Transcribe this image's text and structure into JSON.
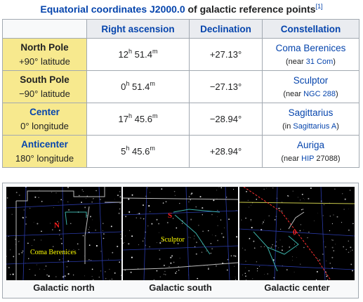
{
  "caption": {
    "link_text": "Equatorial coordinates J2000.0",
    "rest_text": " of galactic reference points",
    "ref": "[1]"
  },
  "table": {
    "headers": [
      "Right ascension",
      "Declination",
      "Constellation"
    ],
    "rows": [
      {
        "name": "North Pole",
        "sub": "+90° latitude",
        "ra_h": "12",
        "ra_m": " 51.4",
        "dec": "+27.13°",
        "constellation": "Coma Berenices",
        "note_pre": "(near ",
        "note_link": "31 Com",
        "note_post": ")"
      },
      {
        "name": "South Pole",
        "sub": "−90° latitude",
        "ra_h": "0",
        "ra_m": " 51.4",
        "dec": "−27.13°",
        "constellation": "Sculptor",
        "note_pre": "(near ",
        "note_link": "NGC 288",
        "note_post": ")"
      },
      {
        "name": "Center",
        "sub": "0° longitude",
        "ra_h": "17",
        "ra_m": " 45.6",
        "dec": "−28.94°",
        "constellation": "Sagittarius",
        "note_pre": "(in ",
        "note_link": "Sagittarius A",
        "note_post": ")"
      },
      {
        "name": "Anticenter",
        "sub": "180° longitude",
        "ra_h": "5",
        "ra_m": " 45.6",
        "dec": "+28.94°",
        "constellation": "Auriga",
        "note_pre": "(near ",
        "note_link": "HIP",
        "note_post": " 27088)"
      }
    ],
    "unit_h": "h",
    "unit_m": "m"
  },
  "gallery": [
    {
      "caption": "Galactic north",
      "map_label": "Coma Berenices",
      "marker": "N"
    },
    {
      "caption": "Galactic south",
      "map_label": "Sculptor",
      "marker": "S"
    },
    {
      "caption": "Galactic center",
      "map_label": "",
      "marker": "0"
    }
  ],
  "colors": {
    "link": "#0645ad",
    "gold_header": "#f7e98e",
    "border": "#a2a9b1",
    "map_label": "#ffff00",
    "marker": "#ff2020"
  }
}
